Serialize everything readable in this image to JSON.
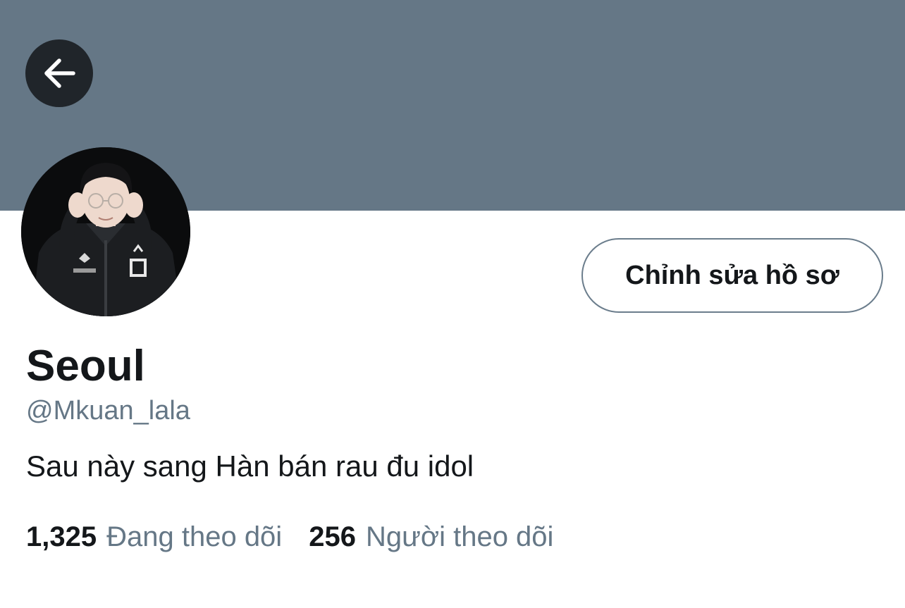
{
  "profile": {
    "display_name": "Seoul",
    "handle": "@Mkuan_lala",
    "bio": "Sau này sang Hàn bán rau đu idol"
  },
  "actions": {
    "edit_profile_label": "Chỉnh sửa hồ sơ"
  },
  "stats": {
    "following_count": "1,325",
    "following_label": "Đang theo dõi",
    "followers_count": "256",
    "followers_label": "Người theo dõi"
  },
  "icons": {
    "back": "arrow-left-icon"
  },
  "colors": {
    "banner": "#657786",
    "back_button_bg": "#20252a",
    "text_primary": "#14171a",
    "text_secondary": "#657786",
    "button_border": "#6b7d8c"
  }
}
